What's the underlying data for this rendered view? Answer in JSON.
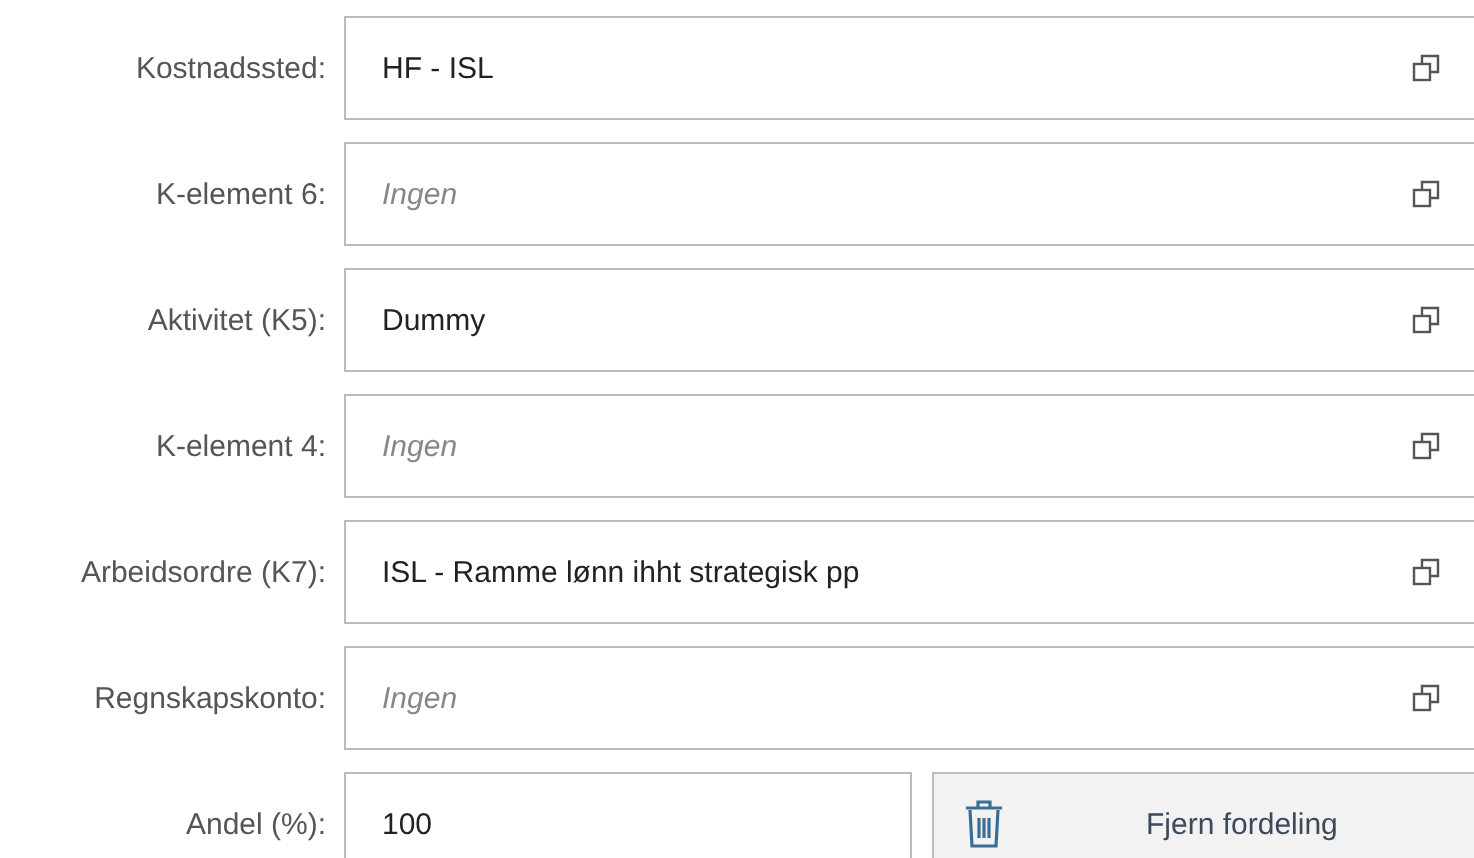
{
  "fields": [
    {
      "label": "Kostnadssted:",
      "value": "HF - ISL"
    },
    {
      "label": "K-element 6:",
      "placeholder": "Ingen"
    },
    {
      "label": "Aktivitet (K5):",
      "value": "Dummy"
    },
    {
      "label": "K-element 4:",
      "placeholder": "Ingen"
    },
    {
      "label": "Arbeidsordre (K7):",
      "value": "ISL - Ramme lønn ihht strategisk pp"
    },
    {
      "label": "Regnskapskonto:",
      "placeholder": "Ingen"
    }
  ],
  "share": {
    "label": "Andel (%):",
    "value": "100"
  },
  "remove_button": {
    "label": "Fjern fordeling"
  }
}
